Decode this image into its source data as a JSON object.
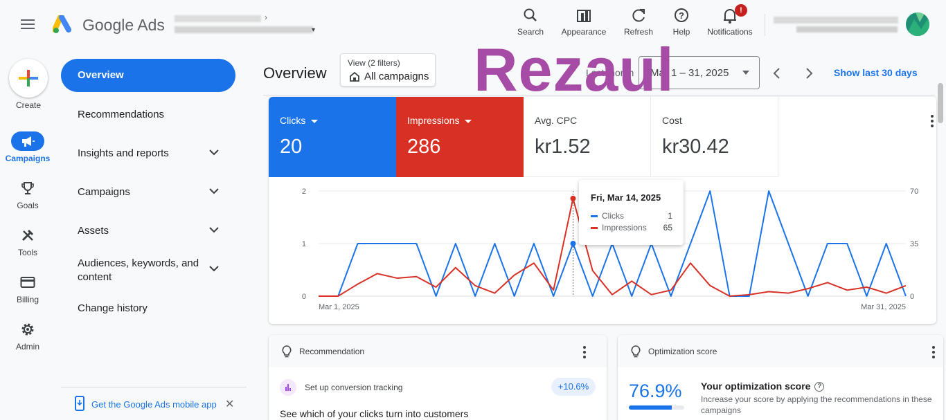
{
  "app": {
    "brand": "Google Ads"
  },
  "toolbar": [
    {
      "label": "Search",
      "icon": "search-icon"
    },
    {
      "label": "Appearance",
      "icon": "appearance-icon"
    },
    {
      "label": "Refresh",
      "icon": "refresh-icon"
    },
    {
      "label": "Help",
      "icon": "help-icon"
    },
    {
      "label": "Notifications",
      "icon": "bell-icon",
      "badge": "!"
    }
  ],
  "rail": {
    "create_label": "Create",
    "items": [
      {
        "label": "Campaigns",
        "icon": "megaphone-icon",
        "active": true
      },
      {
        "label": "Goals",
        "icon": "trophy-icon"
      },
      {
        "label": "Tools",
        "icon": "tools-icon"
      },
      {
        "label": "Billing",
        "icon": "credit-card-icon"
      },
      {
        "label": "Admin",
        "icon": "gear-icon"
      }
    ]
  },
  "nav": {
    "items": [
      {
        "label": "Overview",
        "active": true
      },
      {
        "label": "Recommendations"
      },
      {
        "label": "Insights and reports",
        "expandable": true
      },
      {
        "label": "Campaigns",
        "expandable": true
      },
      {
        "label": "Assets",
        "expandable": true
      },
      {
        "label": "Audiences, keywords, and content",
        "expandable": true
      },
      {
        "label": "Change history"
      }
    ],
    "mobile_app": "Get the Google Ads mobile app"
  },
  "header": {
    "title": "Overview",
    "filter_line1": "View (2 filters)",
    "filter_line2": "All campaigns",
    "watermark": "Rezaul",
    "date_preset": "Last month",
    "date_range": "Mar 1 – 31, 2025",
    "show_last": "Show last 30 days"
  },
  "metrics": [
    {
      "label": "Clicks",
      "value": "20",
      "color": "#1a73e8"
    },
    {
      "label": "Impressions",
      "value": "286",
      "color": "#d93025"
    },
    {
      "label": "Avg. CPC",
      "value": "kr1.52"
    },
    {
      "label": "Cost",
      "value": "kr30.42"
    }
  ],
  "tooltip": {
    "date": "Fri, Mar 14, 2025",
    "rows": [
      {
        "label": "Clicks",
        "value": "1",
        "color": "#1a73e8"
      },
      {
        "label": "Impressions",
        "value": "65",
        "color": "#d93025"
      }
    ]
  },
  "chart_data": {
    "type": "line",
    "x_start_label": "Mar 1, 2025",
    "x_end_label": "Mar 31, 2025",
    "x": [
      1,
      2,
      3,
      4,
      5,
      6,
      7,
      8,
      9,
      10,
      11,
      12,
      13,
      14,
      15,
      16,
      17,
      18,
      19,
      20,
      21,
      22,
      23,
      24,
      25,
      26,
      27,
      28,
      29,
      30,
      31
    ],
    "left_axis": {
      "ticks": [
        "0",
        "1",
        "2"
      ],
      "ylim": [
        0,
        2
      ]
    },
    "right_axis": {
      "ticks": [
        "0",
        "35",
        "70"
      ],
      "ylim": [
        0,
        70
      ]
    },
    "series": [
      {
        "name": "Clicks",
        "axis": "left",
        "color": "#1a73e8",
        "values": [
          0,
          0,
          1,
          1,
          1,
          1,
          0,
          1,
          0,
          1,
          0,
          1,
          0,
          1,
          0,
          1,
          0,
          1,
          0,
          1,
          2,
          0,
          0,
          2,
          1,
          0,
          1,
          1,
          0,
          1,
          0
        ]
      },
      {
        "name": "Impressions",
        "axis": "right",
        "color": "#d93025",
        "values": [
          0,
          0,
          8,
          15,
          12,
          13,
          6,
          19,
          7,
          2,
          14,
          22,
          4,
          65,
          17,
          1,
          10,
          1,
          4,
          22,
          7,
          0,
          1,
          3,
          2,
          5,
          9,
          4,
          6,
          2,
          7
        ]
      }
    ],
    "highlight_index": 13
  },
  "recommendation_card": {
    "title": "Recommendation",
    "item": "Set up conversion tracking",
    "badge": "+10.6%",
    "subtitle": "See which of your clicks turn into customers"
  },
  "optimization_card": {
    "title": "Optimization score",
    "score": "76.9%",
    "score_fraction": 0.769,
    "heading": "Your optimization score",
    "help": "?",
    "description": "Increase your score by applying the recommendations in these campaigns"
  }
}
